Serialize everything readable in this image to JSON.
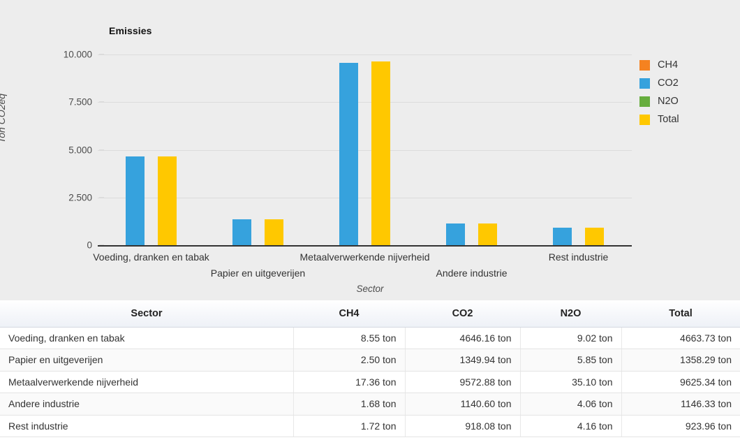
{
  "chart": {
    "title": "Emissies",
    "y_axis_title": "Ton CO2eq",
    "x_axis_title": "Sector",
    "y_ticks": [
      "10.000",
      "7.500",
      "5.000",
      "2.500",
      "0"
    ]
  },
  "legend": {
    "items": [
      {
        "label": "CH4",
        "color": "#f58220"
      },
      {
        "label": "CO2",
        "color": "#36a2dd"
      },
      {
        "label": "N2O",
        "color": "#66ad3d"
      },
      {
        "label": "Total",
        "color": "#ffc800"
      }
    ]
  },
  "chart_data": {
    "type": "bar",
    "title": "Emissies",
    "xlabel": "Sector",
    "ylabel": "Ton CO2eq",
    "ylim": [
      0,
      10000
    ],
    "yticks": [
      0,
      2500,
      5000,
      7500,
      10000
    ],
    "grid": true,
    "legend_position": "right",
    "categories": [
      "Voeding, dranken en tabak",
      "Papier en uitgeverijen",
      "Metaalverwerkende nijverheid",
      "Andere industrie",
      "Rest industrie"
    ],
    "series": [
      {
        "name": "CH4",
        "color": "#f58220",
        "values": [
          8.55,
          2.5,
          17.36,
          1.68,
          1.72
        ]
      },
      {
        "name": "CO2",
        "color": "#36a2dd",
        "values": [
          4646.16,
          1349.94,
          9572.88,
          1140.6,
          918.08
        ]
      },
      {
        "name": "N2O",
        "color": "#66ad3d",
        "values": [
          9.02,
          5.85,
          35.1,
          4.06,
          4.16
        ]
      },
      {
        "name": "Total",
        "color": "#ffc800",
        "values": [
          4663.73,
          1358.29,
          9625.34,
          1146.33,
          923.96
        ]
      }
    ]
  },
  "table": {
    "columns": [
      "Sector",
      "CH4",
      "CO2",
      "N2O",
      "Total"
    ],
    "rows": [
      {
        "sector": "Voeding, dranken en tabak",
        "ch4": "8.55 ton",
        "co2": "4646.16 ton",
        "n2o": "9.02 ton",
        "total": "4663.73 ton"
      },
      {
        "sector": "Papier en uitgeverijen",
        "ch4": "2.50 ton",
        "co2": "1349.94 ton",
        "n2o": "5.85 ton",
        "total": "1358.29 ton"
      },
      {
        "sector": "Metaalverwerkende nijverheid",
        "ch4": "17.36 ton",
        "co2": "9572.88 ton",
        "n2o": "35.10 ton",
        "total": "9625.34 ton"
      },
      {
        "sector": "Andere industrie",
        "ch4": "1.68 ton",
        "co2": "1140.60 ton",
        "n2o": "4.06 ton",
        "total": "1146.33 ton"
      },
      {
        "sector": "Rest industrie",
        "ch4": "1.72 ton",
        "co2": "918.08 ton",
        "n2o": "4.16 ton",
        "total": "923.96 ton"
      }
    ]
  }
}
